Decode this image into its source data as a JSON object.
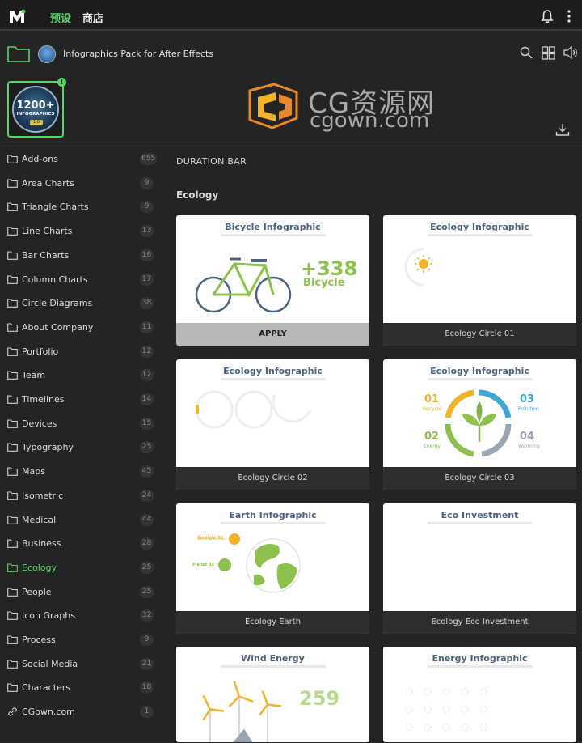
{
  "header": {
    "tabs": [
      {
        "label": "预设",
        "active": true
      },
      {
        "label": "商店",
        "active": false
      }
    ],
    "accent_color": "#55d56a"
  },
  "pack": {
    "title": "Infographics Pack for After Effects",
    "thumb_big": "1200+",
    "thumb_sub": "INFOGRAPHICS",
    "thumb_version": "1.0",
    "badge": "!"
  },
  "watermark": {
    "brand": "CG资源网",
    "url": "cgown.com"
  },
  "sidebar": {
    "items": [
      {
        "label": "Add-ons",
        "count": "655",
        "icon": "folder-icon"
      },
      {
        "label": "Area Charts",
        "count": "9",
        "icon": "folder-icon"
      },
      {
        "label": "Triangle Charts",
        "count": "9",
        "icon": "folder-icon"
      },
      {
        "label": "Line Charts",
        "count": "13",
        "icon": "folder-icon"
      },
      {
        "label": "Bar Charts",
        "count": "16",
        "icon": "folder-icon"
      },
      {
        "label": "Column Charts",
        "count": "17",
        "icon": "folder-icon"
      },
      {
        "label": "Circle Diagrams",
        "count": "38",
        "icon": "folder-icon"
      },
      {
        "label": "About Company",
        "count": "11",
        "icon": "folder-icon"
      },
      {
        "label": "Portfolio",
        "count": "12",
        "icon": "folder-icon"
      },
      {
        "label": "Team",
        "count": "12",
        "icon": "folder-icon"
      },
      {
        "label": "Timelines",
        "count": "14",
        "icon": "folder-icon"
      },
      {
        "label": "Devices",
        "count": "15",
        "icon": "folder-icon"
      },
      {
        "label": "Typography",
        "count": "25",
        "icon": "folder-icon"
      },
      {
        "label": "Maps",
        "count": "45",
        "icon": "folder-icon"
      },
      {
        "label": "Isometric",
        "count": "24",
        "icon": "folder-icon"
      },
      {
        "label": "Medical",
        "count": "44",
        "icon": "folder-icon"
      },
      {
        "label": "Business",
        "count": "28",
        "icon": "folder-icon"
      },
      {
        "label": "Ecology",
        "count": "25",
        "icon": "folder-icon",
        "active": true
      },
      {
        "label": "People",
        "count": "25",
        "icon": "folder-icon"
      },
      {
        "label": "Icon Graphs",
        "count": "32",
        "icon": "folder-icon"
      },
      {
        "label": "Process",
        "count": "9",
        "icon": "folder-icon"
      },
      {
        "label": "Social Media",
        "count": "21",
        "icon": "folder-icon"
      },
      {
        "label": "Characters",
        "count": "18",
        "icon": "folder-icon"
      },
      {
        "label": "CGown.com",
        "count": "1",
        "icon": "link-icon"
      }
    ]
  },
  "main": {
    "section_label": "DURATION BAR",
    "category_title": "Ecology",
    "cards": [
      {
        "title": "Bicycle Infographic",
        "footer": "APPLY",
        "big_value": "+338",
        "big_label": "Bicycle"
      },
      {
        "title": "Ecology Infographic",
        "footer": "Ecology Circle 01"
      },
      {
        "title": "Ecology Infographic",
        "footer": "Ecology Circle 02"
      },
      {
        "title": "Ecology Infographic",
        "footer": "Ecology Circle 03",
        "items": [
          {
            "num": "01",
            "label": "Recycle",
            "color": "#e8b33a"
          },
          {
            "num": "03",
            "label": "Pollution",
            "color": "#3fa7d6"
          },
          {
            "num": "02",
            "label": "Energy",
            "color": "#8dc04c"
          },
          {
            "num": "04",
            "label": "Warming",
            "color": "#9aa5b3"
          }
        ]
      },
      {
        "title": "Earth Infographic",
        "footer": "Ecology Earth",
        "tags": [
          "Sunlight 01",
          "Planet 02"
        ]
      },
      {
        "title": "Eco Investment",
        "footer": "Ecology Eco Investment"
      },
      {
        "title": "Wind Energy",
        "big_value": "259"
      },
      {
        "title": "Energy Infographic"
      }
    ]
  }
}
